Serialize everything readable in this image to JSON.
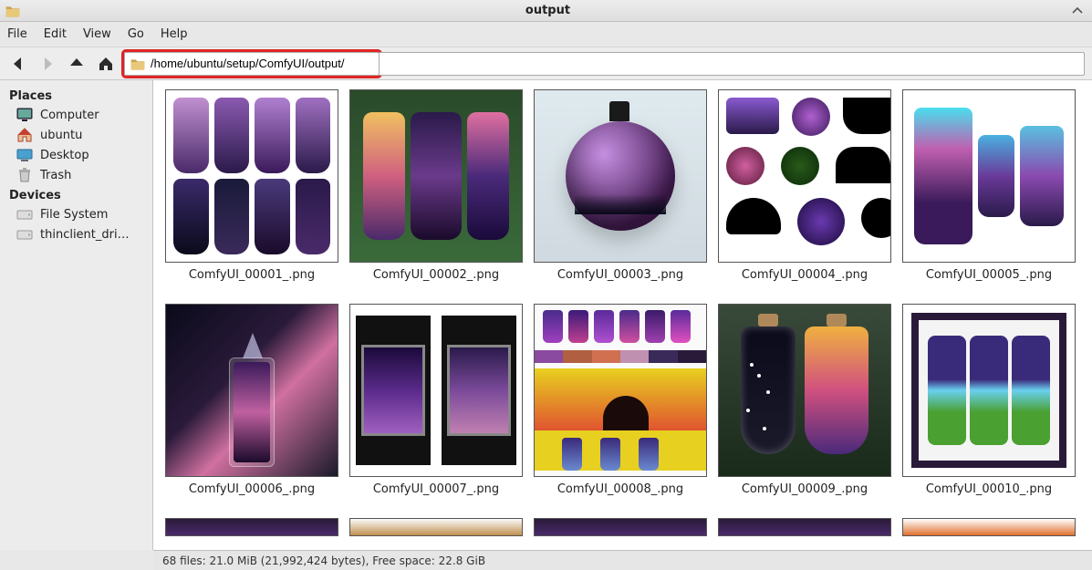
{
  "window": {
    "title": "output"
  },
  "menu": {
    "file": "File",
    "edit": "Edit",
    "view": "View",
    "go": "Go",
    "help": "Help"
  },
  "toolbar": {
    "path": "/home/ubuntu/setup/ComfyUI/output/"
  },
  "sidebar": {
    "places_header": "Places",
    "places": [
      {
        "label": "Computer"
      },
      {
        "label": "ubuntu"
      },
      {
        "label": "Desktop"
      },
      {
        "label": "Trash"
      }
    ],
    "devices_header": "Devices",
    "devices": [
      {
        "label": "File System"
      },
      {
        "label": "thinclient_dri…"
      }
    ]
  },
  "files": [
    {
      "name": "ComfyUI_00001_.png"
    },
    {
      "name": "ComfyUI_00002_.png"
    },
    {
      "name": "ComfyUI_00003_.png"
    },
    {
      "name": "ComfyUI_00004_.png"
    },
    {
      "name": "ComfyUI_00005_.png"
    },
    {
      "name": "ComfyUI_00006_.png"
    },
    {
      "name": "ComfyUI_00007_.png"
    },
    {
      "name": "ComfyUI_00008_.png"
    },
    {
      "name": "ComfyUI_00009_.png"
    },
    {
      "name": "ComfyUI_00010_.png"
    }
  ],
  "status": {
    "text": "68 files: 21.0 MiB (21,992,424 bytes), Free space: 22.8 GiB"
  }
}
